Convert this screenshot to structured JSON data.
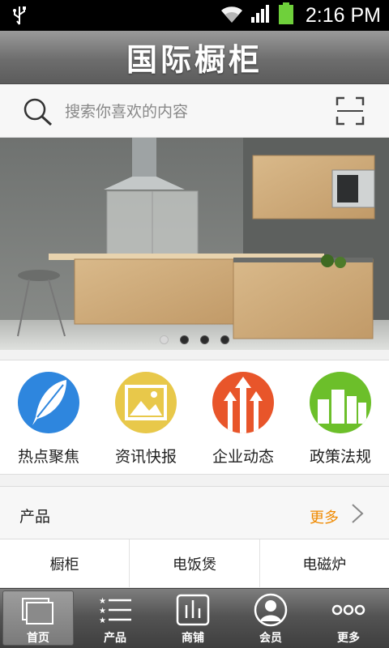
{
  "status_bar": {
    "time": "2:16 PM"
  },
  "header": {
    "title": "国际橱柜"
  },
  "search": {
    "placeholder": "搜索你喜欢的内容"
  },
  "banner": {
    "slide_count": 4,
    "active_slide": 1
  },
  "categories": [
    {
      "label": "热点聚焦",
      "icon": "feather-icon",
      "color": "#2e86de"
    },
    {
      "label": "资讯快报",
      "icon": "picture-icon",
      "color": "#e8c84a"
    },
    {
      "label": "企业动态",
      "icon": "growth-arrows-icon",
      "color": "#e8552a"
    },
    {
      "label": "政策法规",
      "icon": "buildings-icon",
      "color": "#6cbf2a"
    }
  ],
  "products": {
    "title": "产品",
    "more_label": "更多",
    "tabs": [
      "橱柜",
      "电饭煲",
      "电磁炉"
    ]
  },
  "bottom_nav": [
    {
      "label": "首页",
      "icon": "home-icon"
    },
    {
      "label": "产品",
      "icon": "list-icon"
    },
    {
      "label": "商铺",
      "icon": "shop-icon"
    },
    {
      "label": "会员",
      "icon": "member-icon"
    },
    {
      "label": "更多",
      "icon": "more-icon"
    }
  ],
  "colors": {
    "accent_more": "#f08a00"
  }
}
